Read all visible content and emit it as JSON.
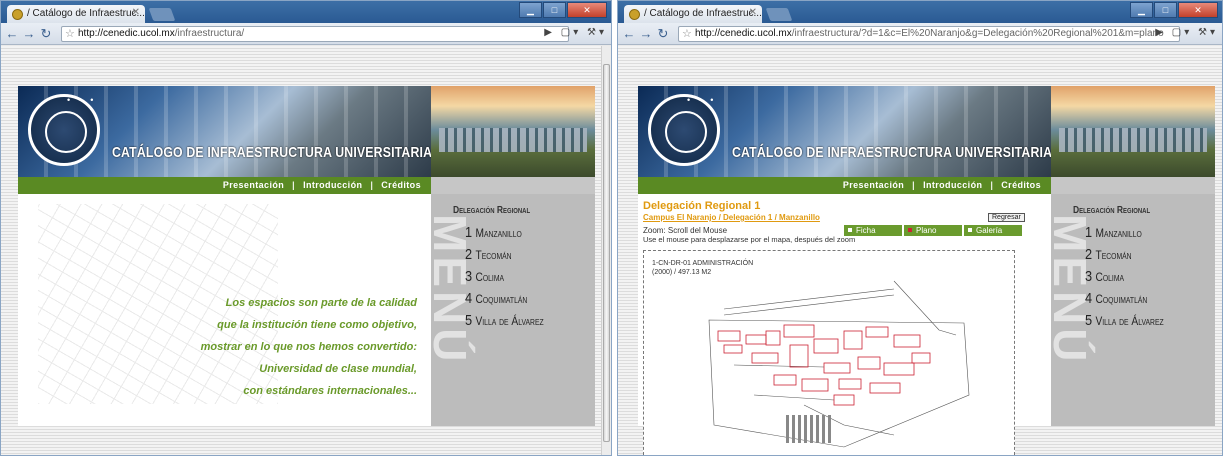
{
  "left": {
    "tab_title": "/ Catálogo de Infraestruc...",
    "url_host": "http://cenedic.ucol.mx",
    "url_path": "/infraestructura/",
    "site_title": "CATÁLOGO DE INFRAESTRUCTURA UNIVERSITARIA",
    "nav": [
      "Presentación",
      "Introducción",
      "Créditos"
    ],
    "slogan": [
      "Los espacios son parte de la calidad",
      "que la institución tiene como objetivo,",
      "mostrar en lo que nos hemos convertido:",
      "Universidad de clase mundial,",
      "con estándares internacionales..."
    ],
    "menu_title": "Delegación Regional",
    "menu_items": [
      {
        "num": "1",
        "label": "Manzanillo"
      },
      {
        "num": "2",
        "label": "Tecomán"
      },
      {
        "num": "3",
        "label": "Colima"
      },
      {
        "num": "4",
        "label": "Coquimatlán"
      },
      {
        "num": "5",
        "label": "Villa de Álvarez"
      }
    ],
    "menu_watermark": "MENÚ"
  },
  "right": {
    "tab_title": "/ Catálogo de Infraestruc...",
    "url_host": "http://cenedic.ucol.mx",
    "url_path": "/infraestructura/?d=1&c=El%20Naranjo&g=Delegación%20Regional%201&m=plano",
    "site_title": "CATÁLOGO DE INFRAESTRUCTURA UNIVERSITARIA",
    "nav": [
      "Presentación",
      "Introducción",
      "Créditos"
    ],
    "delegation_title": "Delegación Regional 1",
    "campus_breadcrumb": "Campus El Naranjo / Delegación 1 / Manzanillo",
    "back_button": "Regresar",
    "zoom_label": "Zoom: Scroll del Mouse",
    "use_label": "Use el mouse para desplazarse por el mapa, después del zoom",
    "view_tabs": [
      "Ficha",
      "Plano",
      "Galería"
    ],
    "map_label_line1": "1-CN-DR-01 ADMINISTRACIÓN",
    "map_label_line2": "(2000) / 497.13 M2",
    "menu_title": "Delegación Regional",
    "menu_items": [
      {
        "num": "1",
        "label": "Manzanillo"
      },
      {
        "num": "2",
        "label": "Tecomán"
      },
      {
        "num": "3",
        "label": "Colima"
      },
      {
        "num": "4",
        "label": "Coquimatlán"
      },
      {
        "num": "5",
        "label": "Villa de Álvarez"
      }
    ],
    "menu_watermark": "MENÚ"
  },
  "colors": {
    "accent_green": "#5a8a23",
    "orange": "#e09a10",
    "menu_gray": "#bcbcbc",
    "map_red": "#c23"
  },
  "icons": [
    "back-arrow-icon",
    "forward-arrow-icon",
    "reload-icon",
    "star-icon",
    "page-menu-icon",
    "wrench-icon"
  ]
}
